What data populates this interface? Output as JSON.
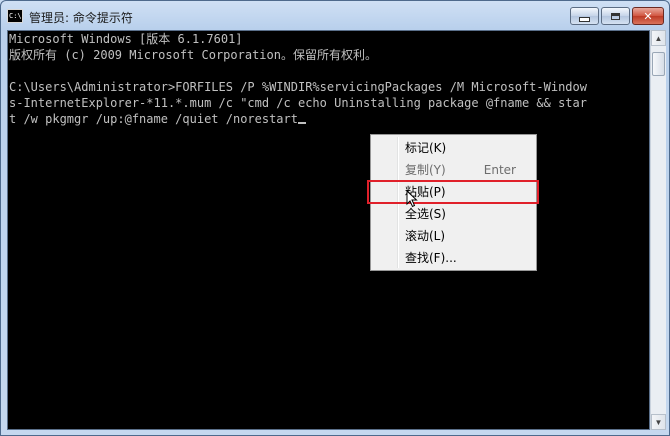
{
  "window": {
    "title": "管理员: 命令提示符",
    "icon_text": "C:\\",
    "controls": {
      "minimize": "minimize-icon",
      "maximize": "maximize-icon",
      "close": "close-icon"
    }
  },
  "console": {
    "lines": [
      "Microsoft Windows [版本 6.1.7601]",
      "版权所有 (c) 2009 Microsoft Corporation。保留所有权利。",
      "",
      "C:\\Users\\Administrator>FORFILES /P %WINDIR%servicingPackages /M Microsoft-Window",
      "s-InternetExplorer-*11.*.mum /c \"cmd /c echo Uninstalling package @fname && star",
      "t /w pkgmgr /up:@fname /quiet /norestart"
    ]
  },
  "context_menu": {
    "items": [
      {
        "label": "标记(K)",
        "shortcut": "",
        "enabled": true
      },
      {
        "label": "复制(Y)",
        "shortcut": "Enter",
        "enabled": false
      },
      {
        "label": "粘贴(P)",
        "shortcut": "",
        "enabled": true,
        "highlighted": true
      },
      {
        "label": "全选(S)",
        "shortcut": "",
        "enabled": true
      },
      {
        "label": "滚动(L)",
        "shortcut": "",
        "enabled": true
      },
      {
        "label": "查找(F)...",
        "shortcut": "",
        "enabled": true
      }
    ]
  },
  "colors": {
    "console_bg": "#000000",
    "console_fg": "#c0c0c0",
    "highlight": "#e0202a"
  }
}
